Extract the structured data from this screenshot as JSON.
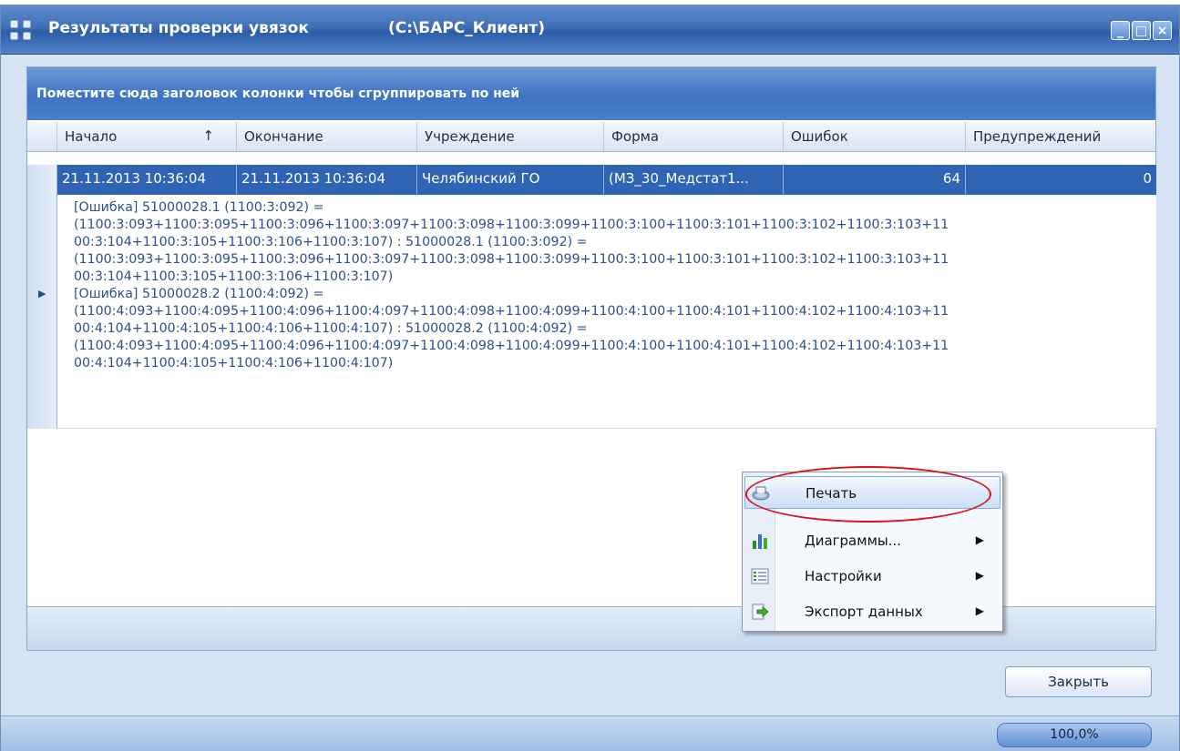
{
  "window": {
    "title": "Результаты проверки увязок",
    "path": "(C:\\БАРС_Клиент)",
    "minimize": "_",
    "maximize": "□",
    "close": "×"
  },
  "grid": {
    "group_hint": "Поместите сюда заголовок колонки чтобы сгруппировать по ней",
    "columns": [
      "Начало",
      "Окончание",
      "Учреждение",
      "Форма",
      "Ошибок",
      "Предупреждений"
    ],
    "sort_arrow": "↑",
    "row": {
      "start": "21.11.2013 10:36:04",
      "end": "21.11.2013 10:36:04",
      "institution": "Челябинский ГО",
      "form": "(МЗ_30_Медстат1...",
      "errors": "64",
      "warnings": "0"
    },
    "details": [
      "[Ошибка] 51000028.1 (1100:3:092) =",
      "(1100:3:093+1100:3:095+1100:3:096+1100:3:097+1100:3:098+1100:3:099+1100:3:100+1100:3:101+1100:3:102+1100:3:103+11",
      "00:3:104+1100:3:105+1100:3:106+1100:3:107) : 51000028.1 (1100:3:092) =",
      "(1100:3:093+1100:3:095+1100:3:096+1100:3:097+1100:3:098+1100:3:099+1100:3:100+1100:3:101+1100:3:102+1100:3:103+11",
      "00:3:104+1100:3:105+1100:3:106+1100:3:107)",
      "[Ошибка] 51000028.2 (1100:4:092) =",
      "(1100:4:093+1100:4:095+1100:4:096+1100:4:097+1100:4:098+1100:4:099+1100:4:100+1100:4:101+1100:4:102+1100:4:103+11",
      "00:4:104+1100:4:105+1100:4:106+1100:4:107) : 51000028.2 (1100:4:092) =",
      "(1100:4:093+1100:4:095+1100:4:096+1100:4:097+1100:4:098+1100:4:099+1100:4:100+1100:4:101+1100:4:102+1100:4:103+11",
      "00:4:104+1100:4:105+1100:4:106+1100:4:107)"
    ]
  },
  "context_menu": {
    "items": [
      {
        "label": "Печать",
        "icon": "printer-icon",
        "submenu": false,
        "highlighted": true
      },
      {
        "label": "Диаграммы...",
        "icon": "bar-chart-icon",
        "submenu": true
      },
      {
        "label": "Настройки",
        "icon": "settings-list-icon",
        "submenu": true
      },
      {
        "label": "Экспорт данных",
        "icon": "export-arrow-icon",
        "submenu": true
      }
    ],
    "submenu_arrow": "▶"
  },
  "buttons": {
    "close": "Закрыть"
  },
  "status": {
    "zoom": "100,0%",
    "zoom_fraction": 1.0
  },
  "colors": {
    "titlebar": "#3f6fb8",
    "selected_row": "#2f63b4",
    "annotation": "#d9141b"
  }
}
